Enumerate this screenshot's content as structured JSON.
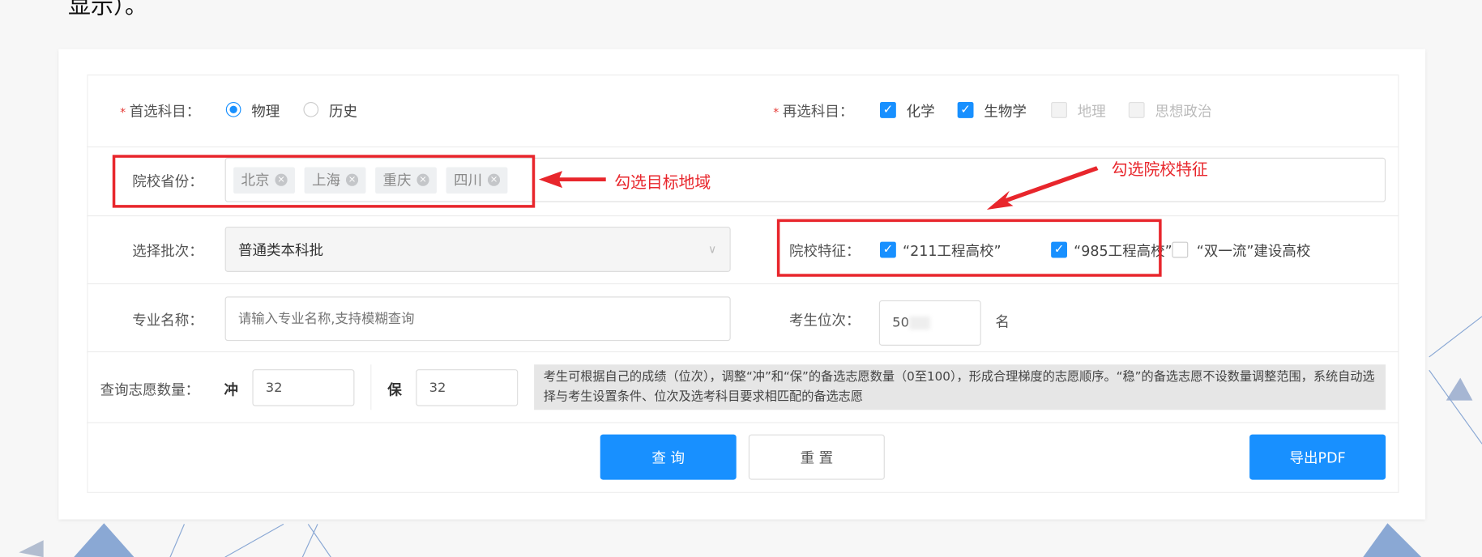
{
  "top_text": "显示）。",
  "row1": {
    "primary_label": "首选科目：",
    "primary_options": [
      {
        "label": "物理",
        "selected": true
      },
      {
        "label": "历史",
        "selected": false
      }
    ],
    "secondary_label": "再选科目：",
    "secondary_options": [
      {
        "label": "化学",
        "checked": true,
        "disabled": false
      },
      {
        "label": "生物学",
        "checked": true,
        "disabled": false
      },
      {
        "label": "地理",
        "checked": false,
        "disabled": true
      },
      {
        "label": "思想政治",
        "checked": false,
        "disabled": true
      }
    ]
  },
  "row2": {
    "label": "院校省份：",
    "tags": [
      "北京",
      "上海",
      "重庆",
      "四川"
    ],
    "annotation": "勾选目标地域",
    "annotation2": "勾选院校特征"
  },
  "row3": {
    "label": "选择批次：",
    "select_value": "普通类本科批",
    "feature_label": "院校特征：",
    "features": [
      {
        "label": "“211工程高校”",
        "checked": true
      },
      {
        "label": "“985工程高校”",
        "checked": true
      },
      {
        "label": "“双一流”建设高校",
        "checked": false
      }
    ]
  },
  "row4": {
    "major_label": "专业名称：",
    "major_placeholder": "请输入专业名称,支持模糊查询",
    "rank_label": "考生位次：",
    "rank_value": "50",
    "rank_unit": "名"
  },
  "row5": {
    "label": "查询志愿数量：",
    "chong_label": "冲",
    "chong_value": "32",
    "bao_label": "保",
    "bao_value": "32",
    "info": "考生可根据自己的成绩（位次），调整“冲”和“保”的备选志愿数量（0至100），形成合理梯度的志愿顺序。“稳”的备选志愿不设数量调整范围，系统自动选择与考生设置条件、位次及选考科目要求相匹配的备选志愿"
  },
  "buttons": {
    "query": "查 询",
    "reset": "重 置",
    "export": "导出PDF"
  },
  "colors": {
    "primary": "#1890ff",
    "annotation": "#e8262c"
  }
}
